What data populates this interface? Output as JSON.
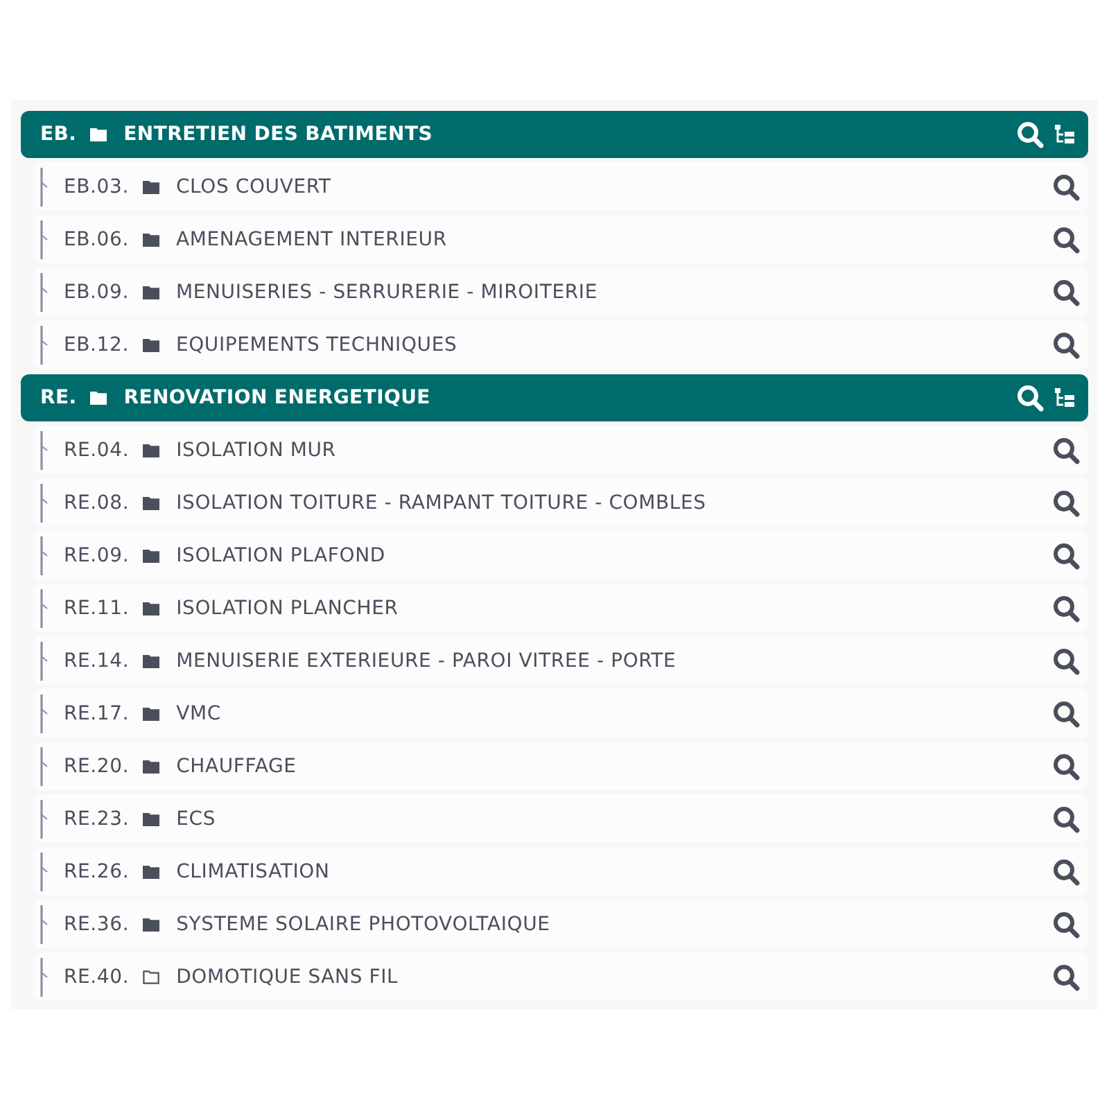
{
  "groups": [
    {
      "code": "EB.",
      "title": "ENTRETIEN DES BATIMENTS",
      "items": [
        {
          "code": "EB.03.",
          "title": "CLOS COUVERT",
          "empty": false
        },
        {
          "code": "EB.06.",
          "title": "AMENAGEMENT INTERIEUR",
          "empty": false
        },
        {
          "code": "EB.09.",
          "title": "MENUISERIES - SERRURERIE - MIROITERIE",
          "empty": false
        },
        {
          "code": "EB.12.",
          "title": "EQUIPEMENTS TECHNIQUES",
          "empty": false
        }
      ]
    },
    {
      "code": "RE.",
      "title": "RENOVATION ENERGETIQUE",
      "items": [
        {
          "code": "RE.04.",
          "title": "ISOLATION MUR",
          "empty": false
        },
        {
          "code": "RE.08.",
          "title": "ISOLATION TOITURE - RAMPANT TOITURE - COMBLES",
          "empty": false
        },
        {
          "code": "RE.09.",
          "title": "ISOLATION PLAFOND",
          "empty": false
        },
        {
          "code": "RE.11.",
          "title": "ISOLATION PLANCHER",
          "empty": false
        },
        {
          "code": "RE.14.",
          "title": "MENUISERIE EXTERIEURE - PAROI VITREE - PORTE",
          "empty": false
        },
        {
          "code": "RE.17.",
          "title": "VMC",
          "empty": false
        },
        {
          "code": "RE.20.",
          "title": "CHAUFFAGE",
          "empty": false
        },
        {
          "code": "RE.23.",
          "title": "ECS",
          "empty": false
        },
        {
          "code": "RE.26.",
          "title": "CLIMATISATION",
          "empty": false
        },
        {
          "code": "RE.36.",
          "title": "SYSTEME SOLAIRE PHOTOVOLTAIQUE",
          "empty": false
        },
        {
          "code": "RE.40.",
          "title": "DOMOTIQUE SANS FIL",
          "empty": true
        }
      ]
    }
  ]
}
